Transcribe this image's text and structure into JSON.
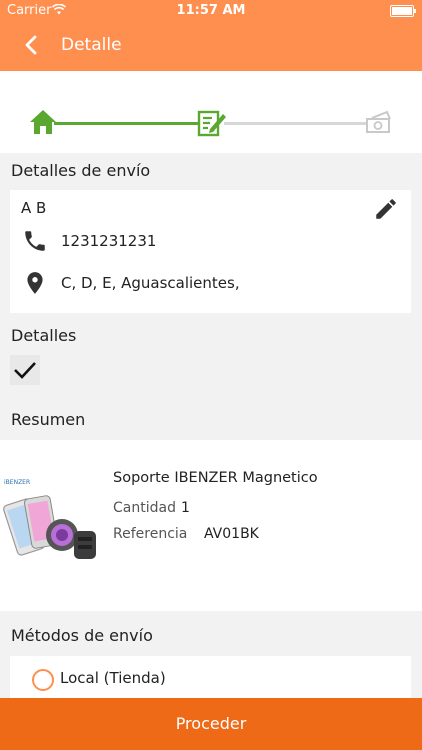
{
  "status_bar": {
    "carrier": "Carrier",
    "time": "11:57 AM"
  },
  "nav": {
    "title": "Detalle",
    "back_icon": "chevron-left-icon"
  },
  "stepper": {
    "steps": [
      {
        "icon": "home-icon",
        "state": "done"
      },
      {
        "icon": "edit-document-icon",
        "state": "current"
      },
      {
        "icon": "money-icon",
        "state": "pending"
      }
    ],
    "colors": {
      "done": "#5aa830",
      "pending": "#d7d7d7"
    }
  },
  "shipping": {
    "title": "Detalles de envío",
    "name": "A B",
    "phone": "1231231231",
    "address": "C, D, E, Aguascalientes,"
  },
  "details": {
    "title": "Detalles",
    "checked": true
  },
  "summary": {
    "title": "Resumen",
    "product": {
      "name": "Soporte IBENZER Magnetico",
      "quantity_label": "Cantidad",
      "quantity": "1",
      "reference_label": "Referencia",
      "reference": "AV01BK",
      "image_brand": "iBENZER"
    }
  },
  "shipping_methods": {
    "title": "Métodos de envío",
    "options": [
      {
        "label": "Local (Tienda)",
        "selected": false
      }
    ]
  },
  "footer": {
    "proceed_label": "Proceder"
  },
  "colors": {
    "accent": "#ff8f4f",
    "button": "#ef6a17",
    "success": "#5aa830"
  }
}
